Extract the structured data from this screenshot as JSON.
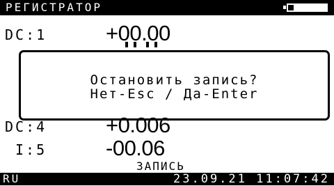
{
  "header": {
    "title": "РЕГИСТРАТОР",
    "battery_icon": "battery-icon",
    "battery_level": 0.15
  },
  "channels": [
    {
      "label": "DC:1",
      "value": "+00.00"
    },
    {
      "label": "DC:4",
      "value": "+0.006"
    },
    {
      "label": "I:5",
      "value": "-00.06"
    }
  ],
  "dialog": {
    "question": "Остановить запись?",
    "options": "Нет-Esc / Да-Enter"
  },
  "status": {
    "text": "ЗАПИСЬ"
  },
  "footer": {
    "language": "RU",
    "datetime": "23.09.21 11:07:42"
  },
  "colors": {
    "background": "#ffffff",
    "foreground": "#000000"
  }
}
